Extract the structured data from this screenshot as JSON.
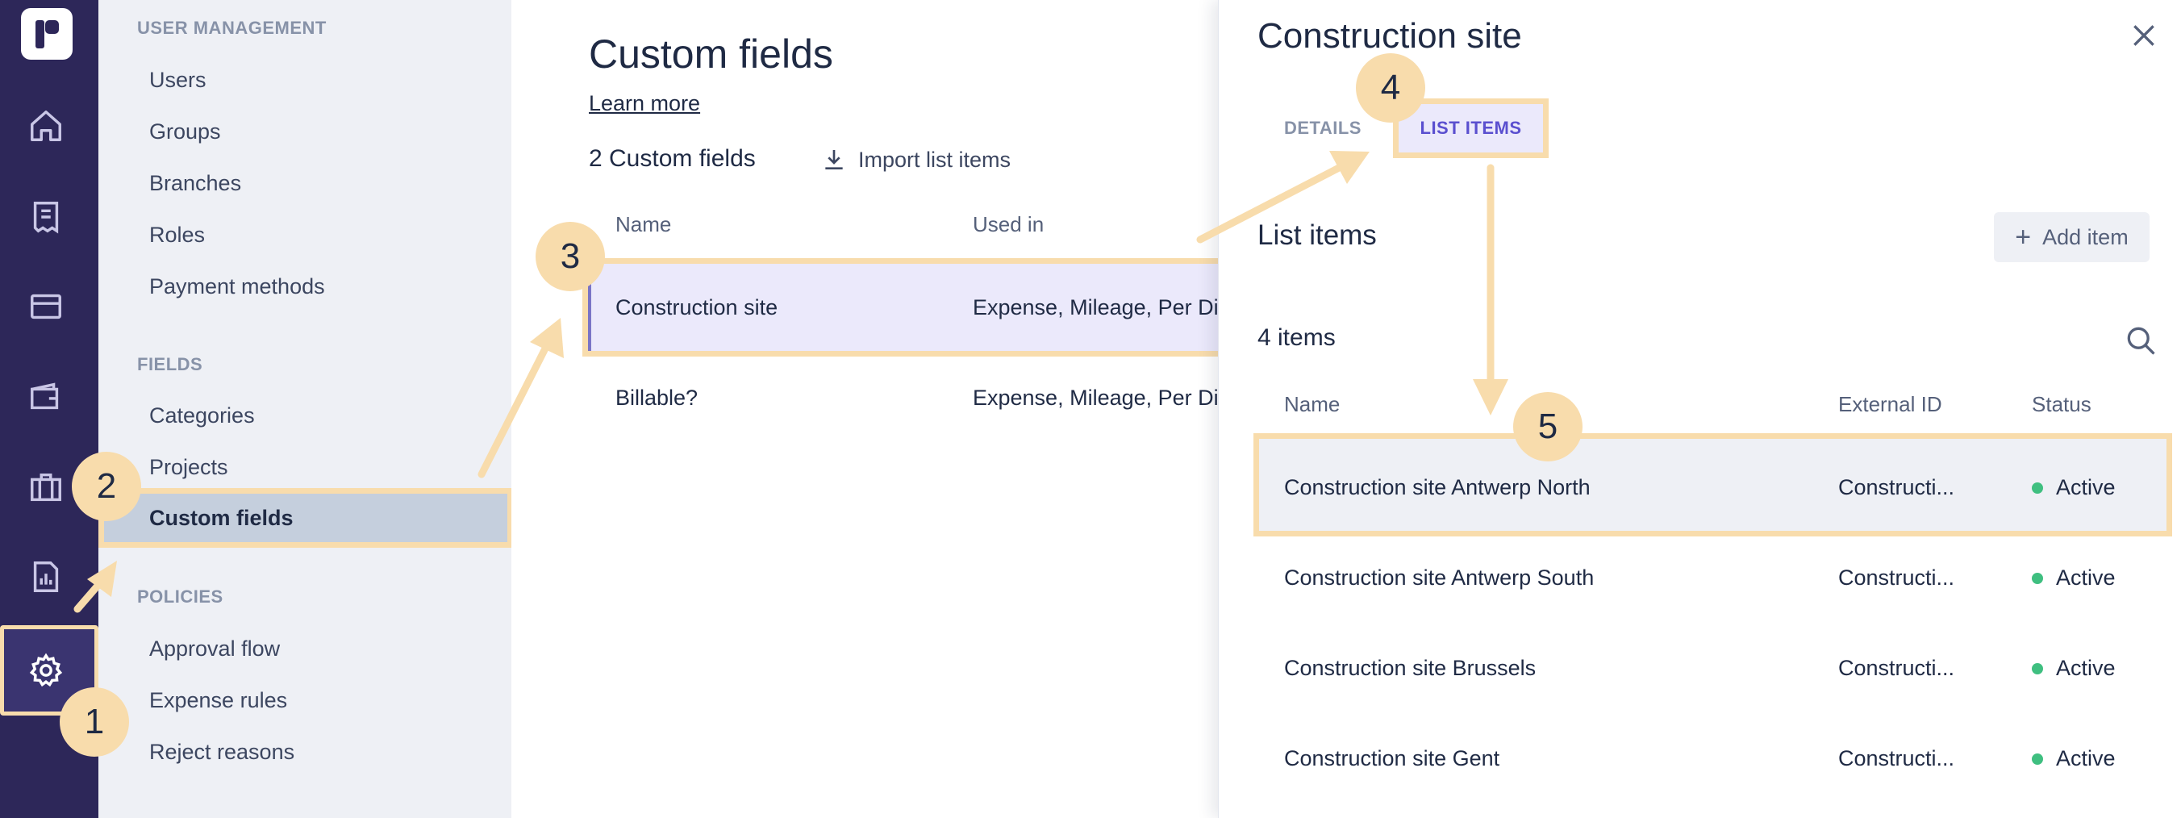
{
  "rail": {
    "icons": [
      "logo-icon",
      "home-icon",
      "receipt-icon",
      "card-icon",
      "wallet-icon",
      "briefcase-icon",
      "report-icon",
      "gear-icon"
    ]
  },
  "sidebar": {
    "sections": [
      {
        "title": "USER MANAGEMENT",
        "items": [
          "Users",
          "Groups",
          "Branches",
          "Roles",
          "Payment methods"
        ]
      },
      {
        "title": "FIELDS",
        "items": [
          "Categories",
          "Projects",
          "Custom fields"
        ]
      },
      {
        "title": "POLICIES",
        "items": [
          "Approval flow",
          "Expense rules",
          "Reject reasons"
        ]
      }
    ],
    "active_item": "Custom fields"
  },
  "main": {
    "title": "Custom fields",
    "learn_more": "Learn more",
    "count": "2 Custom fields",
    "import_label": "Import list items",
    "columns": [
      "Name",
      "Used in"
    ],
    "rows": [
      {
        "name": "Construction site",
        "used_in": "Expense, Mileage, Per Diem"
      },
      {
        "name": "Billable?",
        "used_in": "Expense, Mileage, Per Diem"
      }
    ]
  },
  "panel": {
    "title": "Construction site",
    "tabs": [
      "DETAILS",
      "LIST ITEMS"
    ],
    "active_tab": "LIST ITEMS",
    "subtitle": "List items",
    "add_label": "Add item",
    "items_count": "4 items",
    "columns": [
      "Name",
      "External ID",
      "Status"
    ],
    "items": [
      {
        "name": "Construction site Antwerp North",
        "external_id": "Constructi...",
        "status": "Active"
      },
      {
        "name": "Construction site Antwerp South",
        "external_id": "Constructi...",
        "status": "Active"
      },
      {
        "name": "Construction site Brussels",
        "external_id": "Constructi...",
        "status": "Active"
      },
      {
        "name": "Construction site Gent",
        "external_id": "Constructi...",
        "status": "Active"
      }
    ]
  },
  "annotations": {
    "steps": [
      "1",
      "2",
      "3",
      "4",
      "5"
    ]
  },
  "colors": {
    "rail": "#2d2759",
    "sidebar": "#eef0f5",
    "highlight": "#f8dcac",
    "accent": "#5a4fcf",
    "status_active": "#3fbf80"
  }
}
